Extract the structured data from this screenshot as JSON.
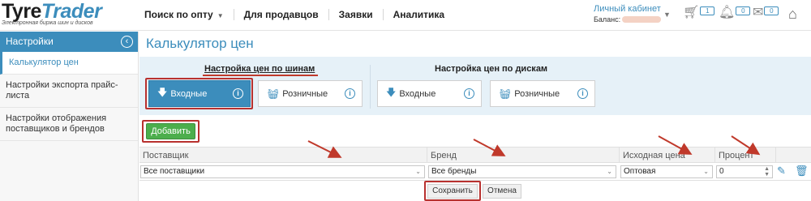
{
  "header": {
    "logo_main": "Tyre",
    "logo_accent": "Trader",
    "logo_tagline": "Электронная биржа шин и дисков",
    "nav": [
      {
        "label": "Поиск по опту",
        "has_caret": true
      },
      {
        "label": "Для продавцов"
      },
      {
        "label": "Заявки"
      },
      {
        "label": "Аналитика"
      }
    ],
    "account_link": "Личный кабинет",
    "balance_label": "Баланс:",
    "cart_count": "1",
    "notifications_count": "0",
    "messages_count": "0"
  },
  "sidebar": {
    "title": "Настройки",
    "items": [
      {
        "label": "Калькулятор цен",
        "active": true
      },
      {
        "label": "Настройки экспорта прайс-листа"
      },
      {
        "label": "Настройки отображения поставщиков и брендов"
      }
    ]
  },
  "main": {
    "title": "Калькулятор цен",
    "tyre_group": {
      "title": "Настройка цен по шинам",
      "buttons": [
        {
          "label": "Входные",
          "icon": "download-arrow-icon",
          "active": true
        },
        {
          "label": "Розничные",
          "icon": "basket-icon"
        }
      ]
    },
    "disk_group": {
      "title": "Настройка цен по дискам",
      "buttons": [
        {
          "label": "Входные",
          "icon": "download-arrow-icon"
        },
        {
          "label": "Розничные",
          "icon": "basket-icon"
        }
      ]
    },
    "add_label": "Добавить",
    "table": {
      "headers": [
        "Поставщик",
        "Бренд",
        "Исходная цена",
        "Процент"
      ],
      "row": {
        "supplier": "Все поставщики",
        "brand": "Все бренды",
        "base_price": "Оптовая",
        "percent": "0"
      }
    },
    "save_label": "Сохранить",
    "cancel_label": "Отмена"
  },
  "colors": {
    "accent": "#3c8dbc",
    "add_button": "#4cae4c",
    "highlight_red": "#b8312f"
  }
}
